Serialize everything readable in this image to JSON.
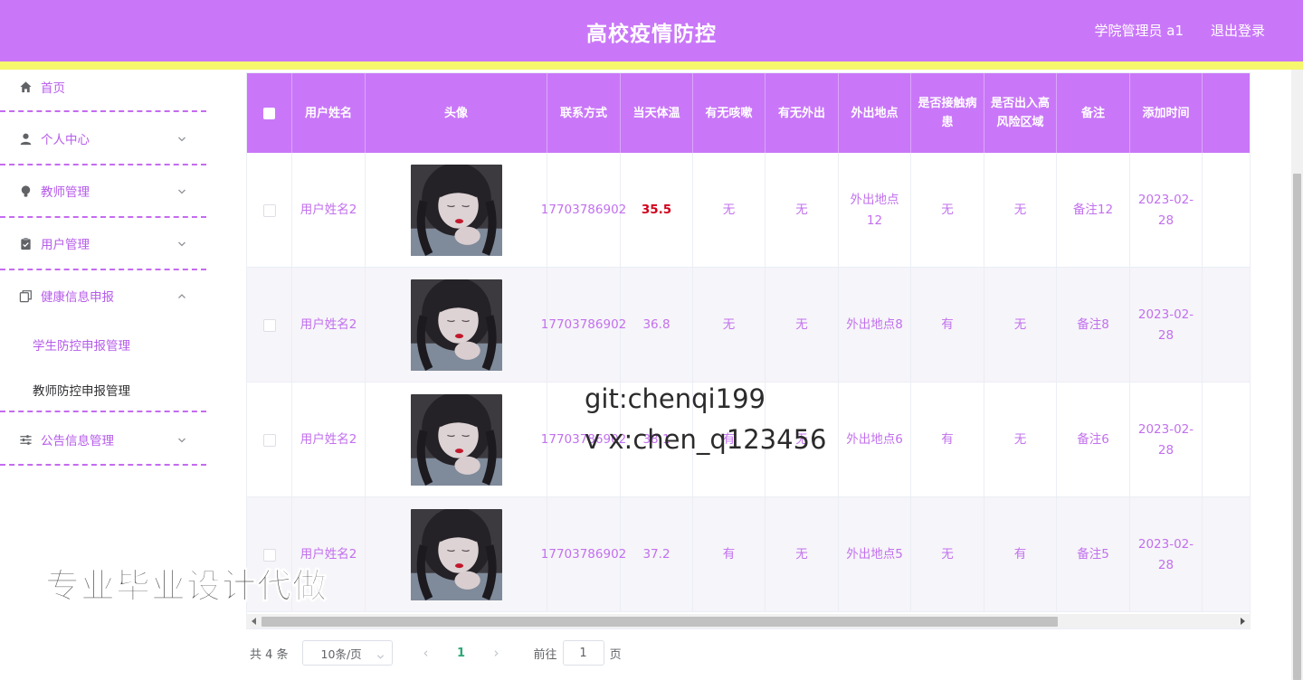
{
  "header": {
    "title": "高校疫情防控",
    "user_label": "学院管理员 a1",
    "logout_label": "退出登录"
  },
  "sidebar": {
    "items": [
      {
        "label": "首页",
        "icon": "home-icon"
      },
      {
        "label": "个人中心",
        "icon": "user-icon"
      },
      {
        "label": "教师管理",
        "icon": "bulb-icon"
      },
      {
        "label": "用户管理",
        "icon": "clipboard-icon"
      },
      {
        "label": "健康信息申报",
        "icon": "copy-icon"
      },
      {
        "label": "公告信息管理",
        "icon": "sliders-icon"
      }
    ],
    "sub_items": [
      {
        "label": "学生防控申报管理"
      },
      {
        "label": "教师防控申报管理"
      }
    ]
  },
  "table": {
    "columns": [
      "用户姓名",
      "头像",
      "联系方式",
      "当天体温",
      "有无咳嗽",
      "有无外出",
      "外出地点",
      "是否接触病患",
      "是否出入高风险区域",
      "备注",
      "添加时间"
    ],
    "rows": [
      {
        "name": "用户姓名2",
        "phone": "17703786902",
        "temp": "35.5",
        "cough": "无",
        "out": "无",
        "place": "外出地点12",
        "contact": "无",
        "risk": "无",
        "note": "备注12",
        "time": "2023-02-28"
      },
      {
        "name": "用户姓名2",
        "phone": "17703786902",
        "temp": "36.8",
        "cough": "无",
        "out": "无",
        "place": "外出地点8",
        "contact": "有",
        "risk": "无",
        "note": "备注8",
        "time": "2023-02-28"
      },
      {
        "name": "用户姓名2",
        "phone": "17703786902",
        "temp": "38.1",
        "cough": "有",
        "out": "无",
        "place": "外出地点6",
        "contact": "有",
        "risk": "无",
        "note": "备注6",
        "time": "2023-02-28"
      },
      {
        "name": "用户姓名2",
        "phone": "17703786902",
        "temp": "37.2",
        "cough": "有",
        "out": "无",
        "place": "外出地点5",
        "contact": "无",
        "risk": "有",
        "note": "备注5",
        "time": "2023-02-28"
      }
    ]
  },
  "pagination": {
    "total": "共 4 条",
    "page_size": "10条/页",
    "current_page": "1",
    "goto_label": "前往",
    "goto_value": "1",
    "page_suffix": "页"
  },
  "watermark": {
    "line1": "git:chenqi199",
    "line2": "v x:chen_q123456",
    "line3": "专业毕业设计代做"
  },
  "colors": {
    "header": "#c977f8",
    "accent_bar": "#f6f76c",
    "menu_text": "#b65bea",
    "cell_text": "#c270ee",
    "hot_temp": "#d0021b"
  }
}
